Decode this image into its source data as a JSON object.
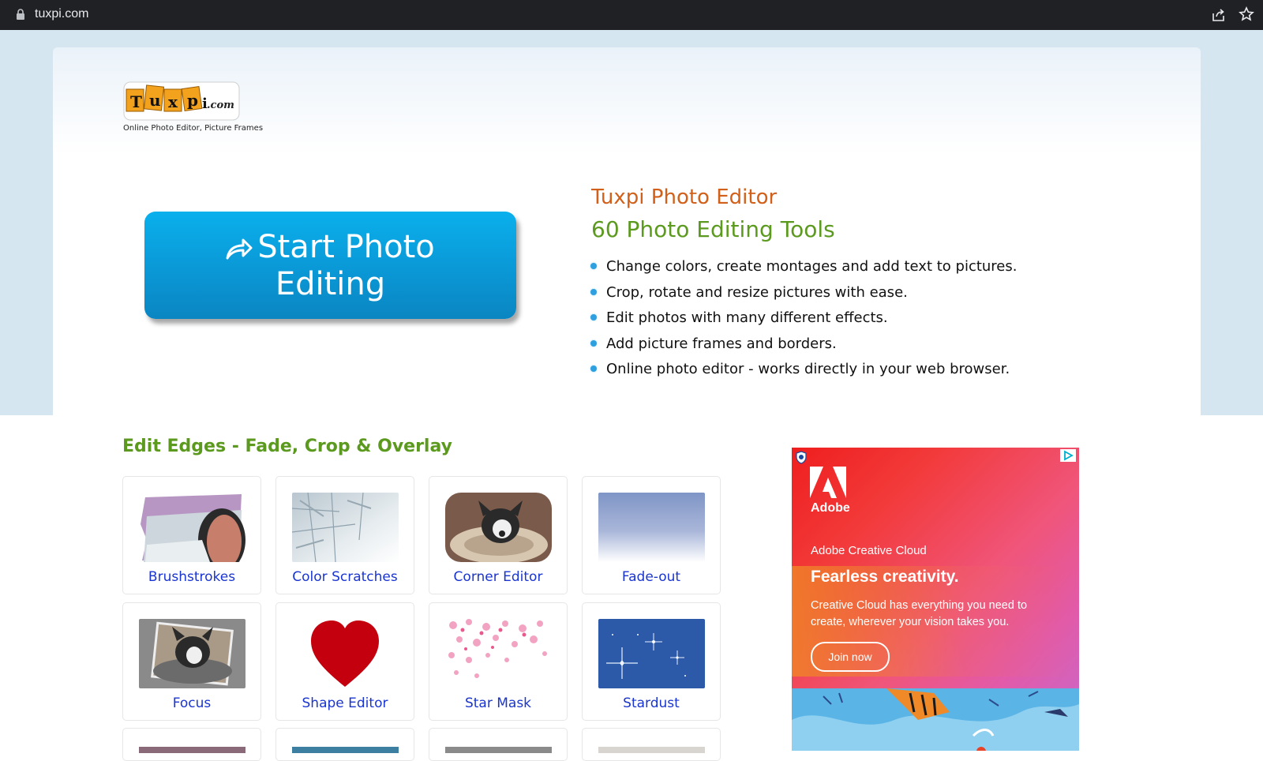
{
  "browser": {
    "url": "tuxpi.com"
  },
  "header": {
    "tagline": "Online Photo Editor, Picture Frames"
  },
  "hero": {
    "start_button_line1": "Start Photo",
    "start_button_line2": "Editing",
    "title": "Tuxpi Photo Editor",
    "subtitle": "60 Photo Editing Tools",
    "features": [
      "Change colors, create montages and add text to pictures.",
      "Crop, rotate and resize pictures with ease.",
      "Edit photos with many different effects.",
      "Add picture frames and borders.",
      "Online photo editor - works directly in your web browser."
    ]
  },
  "section": {
    "title": "Edit Edges - Fade, Crop & Overlay",
    "tiles": [
      {
        "label": "Brushstrokes"
      },
      {
        "label": "Color Scratches"
      },
      {
        "label": "Corner Editor"
      },
      {
        "label": "Fade-out"
      },
      {
        "label": "Focus"
      },
      {
        "label": "Shape Editor"
      },
      {
        "label": "Star Mask"
      },
      {
        "label": "Stardust"
      }
    ]
  },
  "ad": {
    "brand": "Adobe",
    "product": "Adobe Creative Cloud",
    "headline": "Fearless creativity.",
    "body": "Creative Cloud has everything you need to create, wherever your vision takes you.",
    "cta": "Join now"
  },
  "colors": {
    "accent_orange": "#d0601a",
    "accent_green": "#5b9a1e",
    "link_blue": "#1a35d0",
    "button_blue": "#0a9ad8"
  }
}
